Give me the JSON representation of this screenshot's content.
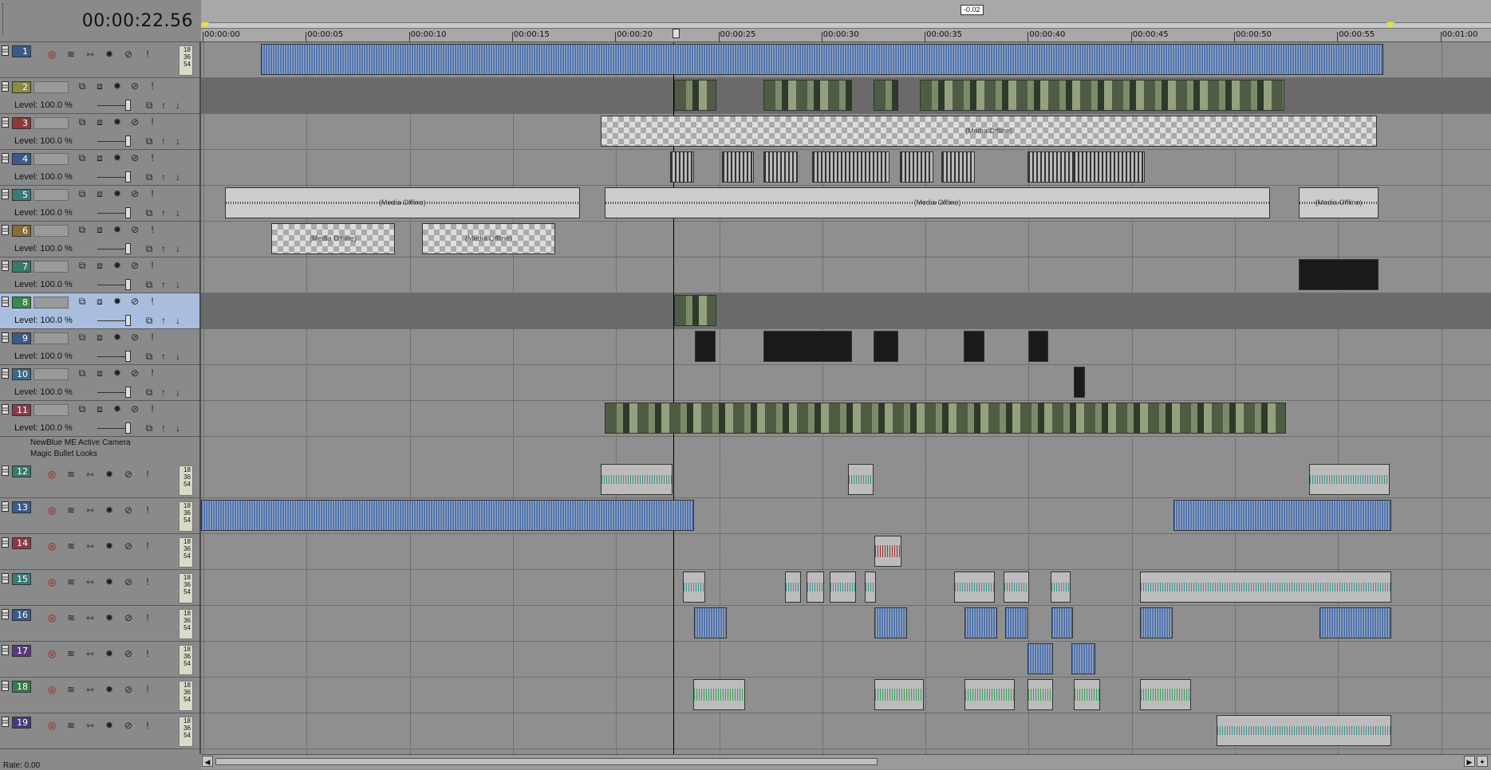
{
  "timecode": "00:00:22.56",
  "marker_label": "-0.02",
  "ruler": {
    "labels": [
      "00:00:00",
      "00:00:05",
      "00:00:10",
      "00:00:15",
      "00:00:20",
      "00:00:25",
      "00:00:30",
      "00:00:35",
      "00:00:40",
      "00:00:45",
      "00:00:50",
      "00:00:55",
      "00:01:00"
    ]
  },
  "tracks": [
    {
      "num": "1",
      "kind": "audio",
      "color": "#3a5a8a"
    },
    {
      "num": "2",
      "kind": "video",
      "color": "#8a8a40",
      "level": "Level: 100.0 %"
    },
    {
      "num": "3",
      "kind": "video",
      "color": "#8a3a3a",
      "level": "Level: 100.0 %"
    },
    {
      "num": "4",
      "kind": "video",
      "color": "#3a5a8a",
      "level": "Level: 100.0 %"
    },
    {
      "num": "5",
      "kind": "video",
      "color": "#3a7a7a",
      "level": "Level: 100.0 %"
    },
    {
      "num": "6",
      "kind": "video",
      "color": "#8a6a3a",
      "level": "Level: 100.0 %"
    },
    {
      "num": "7",
      "kind": "video",
      "color": "#3a7a6a",
      "level": "Level: 100.0 %"
    },
    {
      "num": "8",
      "kind": "video",
      "color": "#3a8a4a",
      "level": "Level: 100.0 %",
      "selected": true
    },
    {
      "num": "9",
      "kind": "video",
      "color": "#3a5a8a",
      "level": "Level: 100.0 %"
    },
    {
      "num": "10",
      "kind": "video",
      "color": "#3a6a8a",
      "level": "Level: 100.0 %"
    },
    {
      "num": "11",
      "kind": "video",
      "color": "#8a3a4a",
      "level": "Level: 100.0 %"
    },
    {
      "num": "12",
      "kind": "audio",
      "color": "#3a7a6a"
    },
    {
      "num": "13",
      "kind": "audio",
      "color": "#3a5a8a"
    },
    {
      "num": "14",
      "kind": "audio",
      "color": "#8a3a4a"
    },
    {
      "num": "15",
      "kind": "audio",
      "color": "#3a7a7a"
    },
    {
      "num": "16",
      "kind": "audio",
      "color": "#3a5a8a"
    },
    {
      "num": "17",
      "kind": "audio",
      "color": "#5a3a7a"
    },
    {
      "num": "18",
      "kind": "audio",
      "color": "#3a7a4a"
    },
    {
      "num": "19",
      "kind": "audio",
      "color": "#4a3a7a"
    }
  ],
  "bus_labels": [
    "NewBlue ME Active Camera",
    "Magic Bullet Looks"
  ],
  "meter_text": "18\n36\n54",
  "media_offline": "(Media Offline)",
  "rate": "Rate: 0.00"
}
